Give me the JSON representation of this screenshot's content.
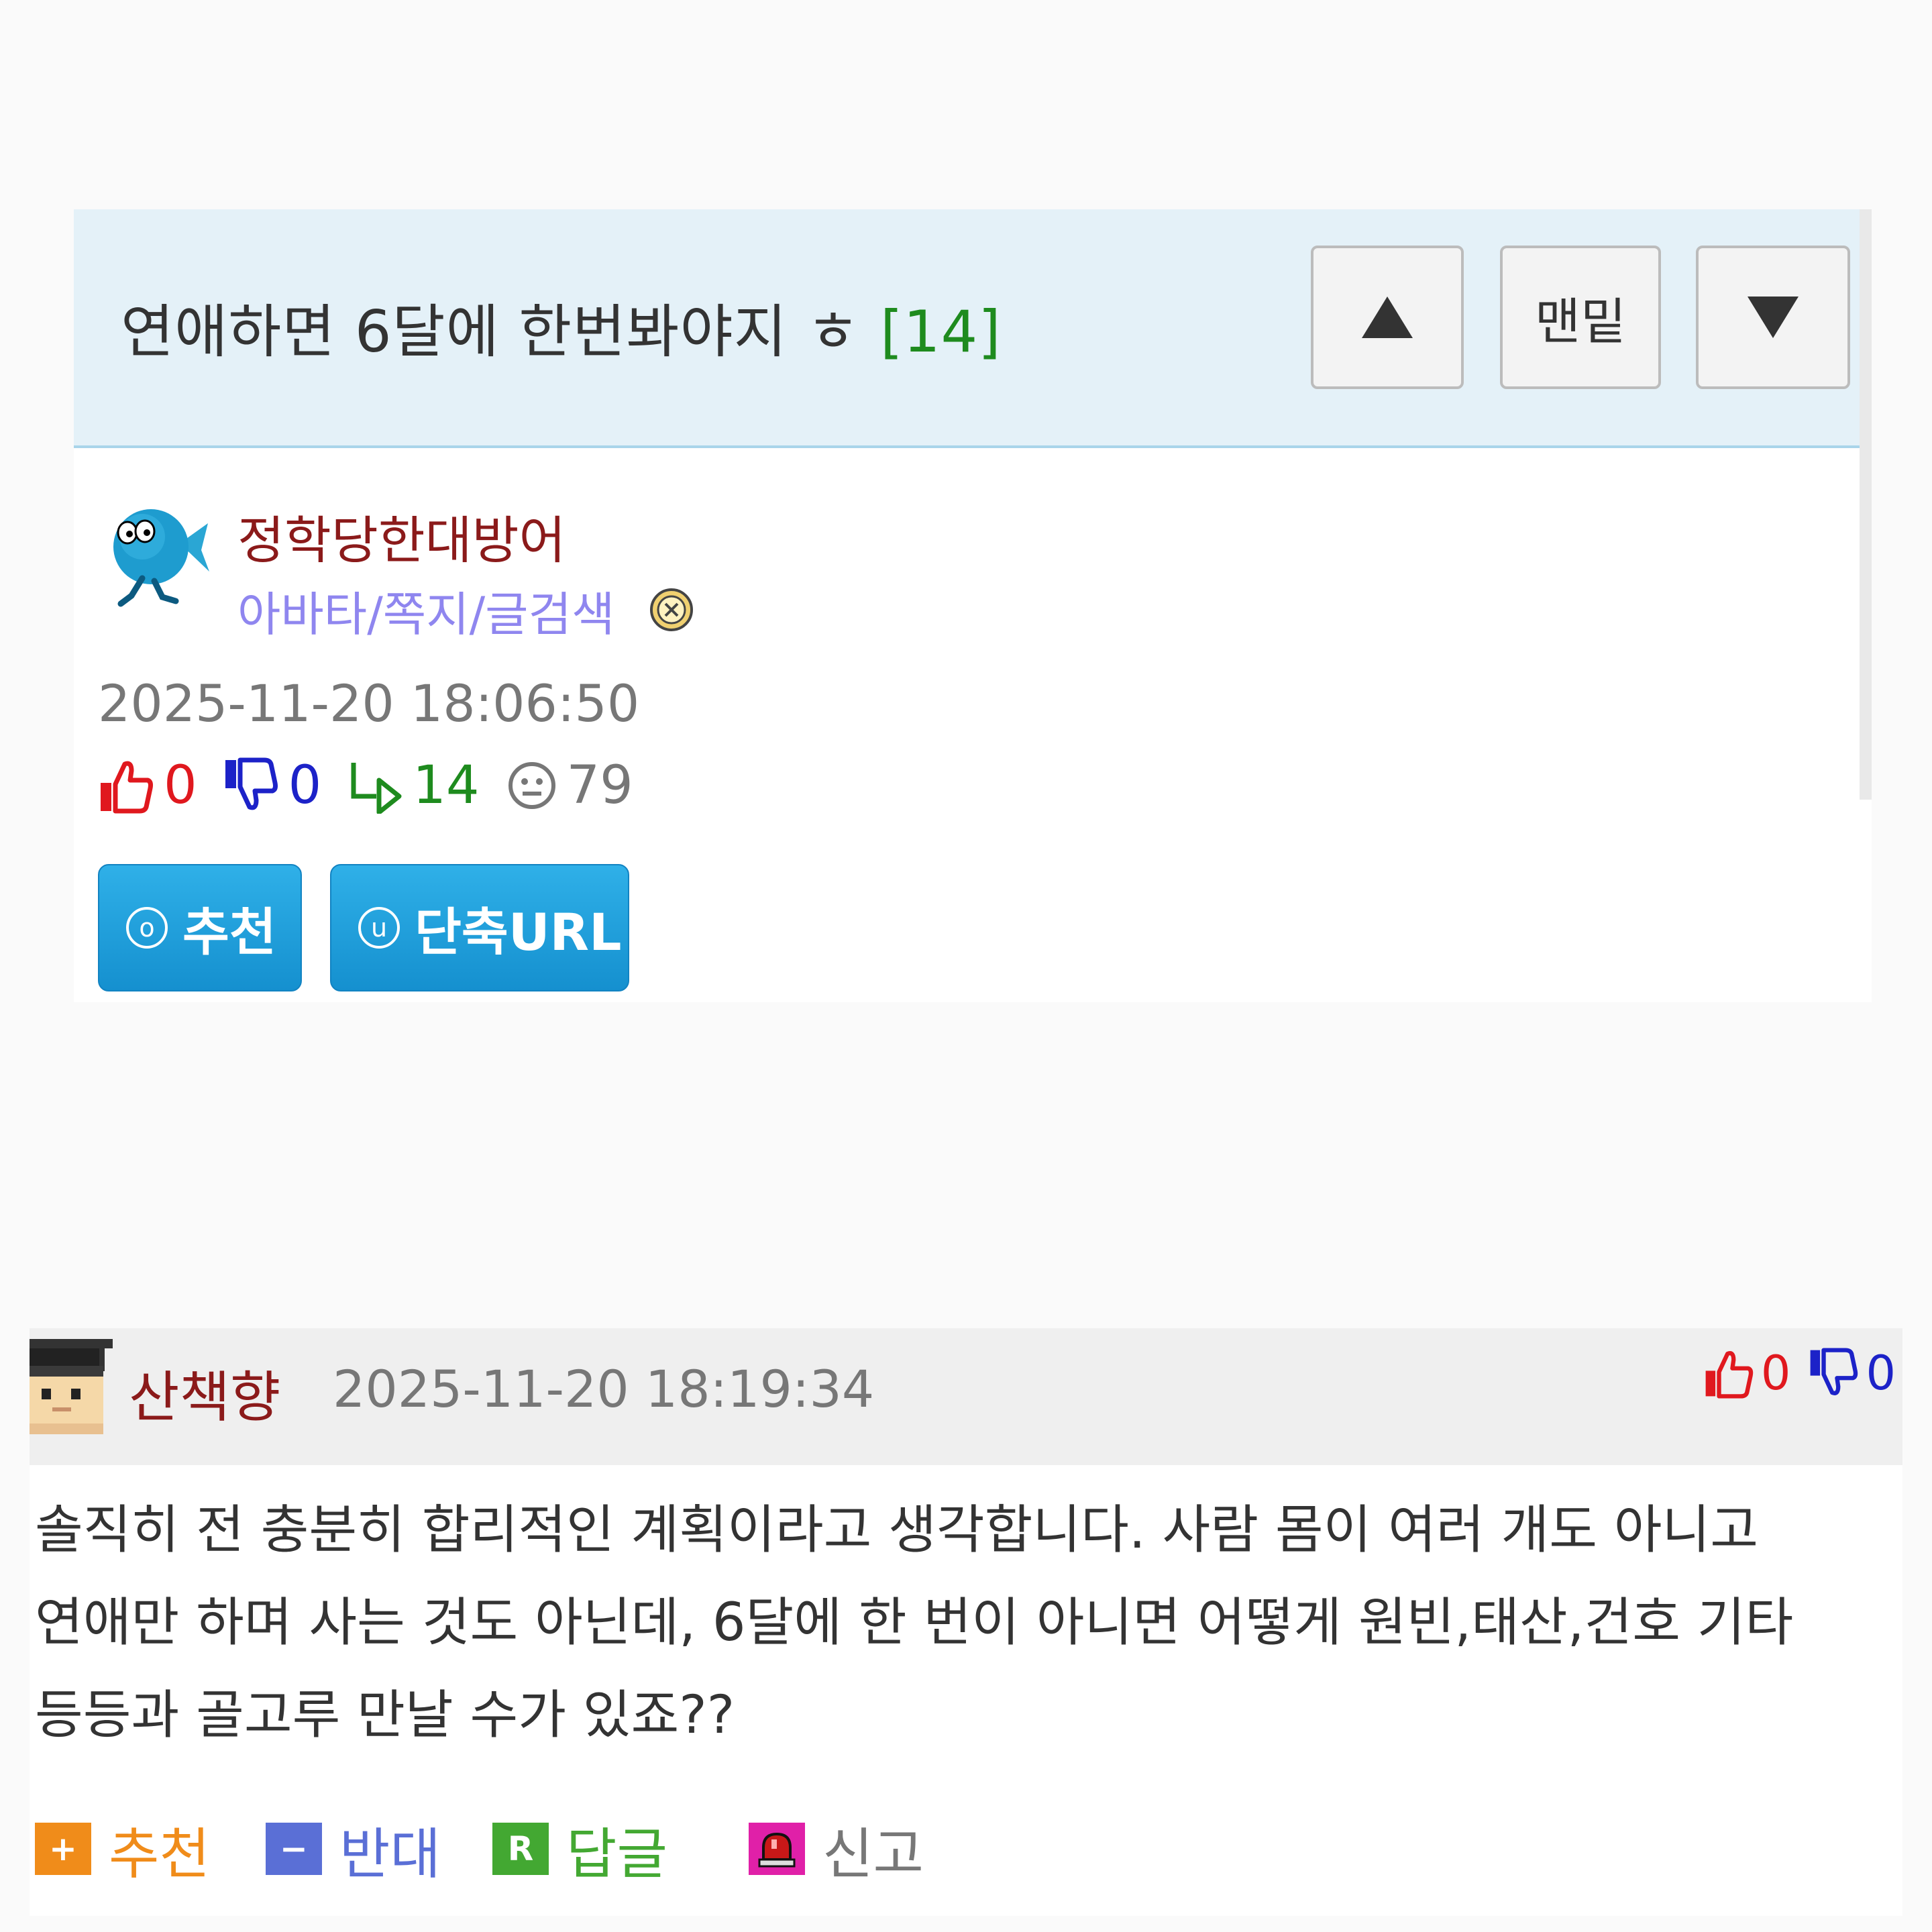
{
  "post": {
    "title": "연애하면 6달에 한번봐야지 ㅎ",
    "comment_count": "[14]",
    "nav": {
      "up_icon": "triangle-up-icon",
      "bottom_label": "맨밑",
      "down_icon": "triangle-down-icon"
    },
    "author": "정학당한대방어",
    "author_links": "아바타/쪽지/글검색",
    "date": "2025-11-20 18:06:50",
    "stats": {
      "upvotes": "0",
      "downvotes": "0",
      "replies": "14",
      "views": "79"
    },
    "buttons": {
      "recommend_glyph": "o",
      "recommend": "추천",
      "shorturl_glyph": "u",
      "shorturl": "단축URL"
    }
  },
  "comment": {
    "author": "산책향",
    "date": "2025-11-20 18:19:34",
    "upvotes": "0",
    "downvotes": "0",
    "body_lines": [
      "솔직히 전 충분히 합리적인 계획이라고 생각합니다. 사람 몸이 여러 개도 아니고",
      "연애만 하며 사는 것도 아닌데, 6달에 한 번이 아니면 어떻게 원빈,태산,건호 기타",
      "등등과 골고루 만날 수가 있죠??"
    ],
    "actions": {
      "recommend_glyph": "+",
      "recommend": "추천",
      "oppose_glyph": "−",
      "oppose": "반대",
      "reply_glyph": "R",
      "reply": "답글",
      "report": "신고"
    }
  },
  "colors": {
    "header_bg": "#e4f1f8",
    "author": "#8b1a1a",
    "link": "#8f86ef",
    "up": "#e0181e",
    "down": "#1c22c8",
    "reply": "#1e8b1e",
    "button": "#1a9ad8",
    "act_recommend": "#f08c1a",
    "act_oppose": "#5a6fd6",
    "act_reply": "#43a832",
    "act_report": "#e020a8"
  }
}
